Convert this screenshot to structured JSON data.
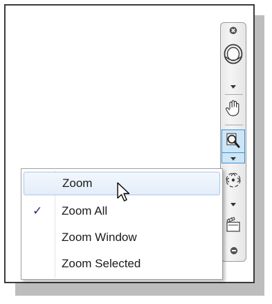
{
  "menu": {
    "items": [
      {
        "label": "Zoom",
        "checked": false,
        "highlighted": true
      },
      {
        "label": "Zoom All",
        "checked": true,
        "highlighted": false
      },
      {
        "label": "Zoom Window",
        "checked": false,
        "highlighted": false
      },
      {
        "label": "Zoom Selected",
        "checked": false,
        "highlighted": false
      }
    ],
    "check_glyph": "✓"
  },
  "navbar": {
    "tools": [
      "close-icon",
      "steering-wheel-icon",
      "pan-hand-icon",
      "zoom-magnifier-icon",
      "orbit-icon",
      "showmotion-icon",
      "customize-icon"
    ],
    "active_tool": "zoom-magnifier-icon"
  },
  "colors": {
    "highlight_border": "#3c8fd0",
    "highlight_fill": "#cde6f7",
    "check": "#222a73"
  }
}
